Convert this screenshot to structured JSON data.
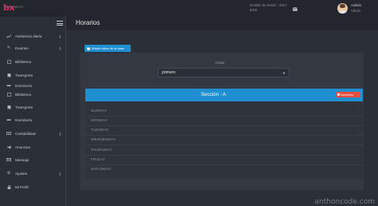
{
  "topbar": {
    "brand": "bx",
    "session": "Gestión de sesión : 2017-2018",
    "mail_icon": "mail-icon",
    "user_name": "Admin",
    "user_role": "Admin"
  },
  "sidebar": {
    "heading": "Navegación",
    "items": [
      {
        "label": "Asistencia diaria",
        "icon": "chart-icon",
        "has_children": true
      },
      {
        "label": "Examen",
        "icon": "edit-icon",
        "has_children": true
      },
      {
        "label": "Biblioteca",
        "icon": "book-icon",
        "has_children": false
      },
      {
        "label": "Transporte",
        "icon": "bus-icon",
        "has_children": false
      },
      {
        "label": "Dormitorio",
        "icon": "bed-icon",
        "has_children": false
      },
      {
        "label": "Biblioteca",
        "icon": "book-icon",
        "has_children": false
      },
      {
        "label": "Transporte",
        "icon": "bus-icon",
        "has_children": false
      },
      {
        "label": "Dormitorio",
        "icon": "bed-icon",
        "has_children": false
      },
      {
        "label": "Contabilidad",
        "icon": "money-icon",
        "has_children": true
      },
      {
        "label": "Anuncios",
        "icon": "announcement-icon",
        "has_children": false
      },
      {
        "label": "Mensaje",
        "icon": "envelope-icon",
        "has_children": false
      },
      {
        "label": "Ajustes",
        "icon": "gear-icon",
        "has_children": true
      },
      {
        "label": "Mi Perfil",
        "icon": "lock-icon",
        "has_children": false
      }
    ]
  },
  "header": {
    "title": "Horarios"
  },
  "main": {
    "add_button": "Añadir rutina de la clase",
    "class_label": "Clase",
    "class_value": "primero",
    "section_title": "Sección - A",
    "print_button": "Impresión",
    "days": [
      "SUNDAY",
      "MONDAY",
      "TUESDAY",
      "WEDNESDAY",
      "THURSDAY",
      "FRIDAY",
      "SATURDAY"
    ]
  },
  "watermark": "anthoncode.com",
  "colors": {
    "accent": "#1f8fd1",
    "brand": "#e0245e",
    "danger": "#e74c3c",
    "background": "#2b2f36",
    "panel": "#343941"
  }
}
